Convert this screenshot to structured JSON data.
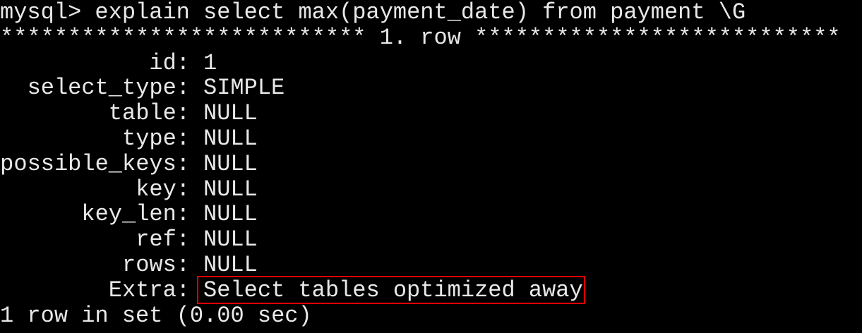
{
  "terminal": {
    "prompt": "mysql> explain select max(payment_date) from payment \\G",
    "row_header": "*************************** 1. row ***************************",
    "fields": [
      {
        "label": "id:",
        "value": "1"
      },
      {
        "label": "select_type:",
        "value": "SIMPLE"
      },
      {
        "label": "table:",
        "value": "NULL"
      },
      {
        "label": "type:",
        "value": "NULL"
      },
      {
        "label": "possible_keys:",
        "value": "NULL"
      },
      {
        "label": "key:",
        "value": "NULL"
      },
      {
        "label": "key_len:",
        "value": "NULL"
      },
      {
        "label": "ref:",
        "value": "NULL"
      },
      {
        "label": "rows:",
        "value": "NULL"
      },
      {
        "label": "Extra:",
        "value": "Select tables optimized away"
      }
    ],
    "footer": "1 row in set (0.00 sec)",
    "highlight_color": "#e00000",
    "text_color": "#e8e8e8",
    "background_color": "#000000"
  }
}
